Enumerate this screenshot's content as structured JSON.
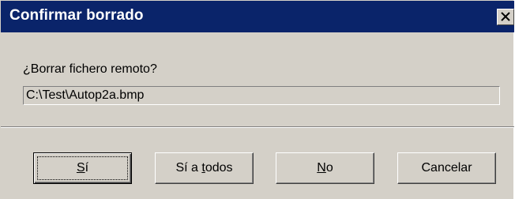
{
  "window": {
    "title": "Confirmar borrado",
    "close_icon": "close-icon"
  },
  "message": {
    "prompt": "¿Borrar fichero remoto?",
    "path": "C:\\Test\\Autop2a.bmp"
  },
  "buttons": {
    "yes": {
      "pre": "",
      "mnemonic": "S",
      "post": "í"
    },
    "yes_all": {
      "pre": "Sí a ",
      "mnemonic": "t",
      "post": "odos"
    },
    "no": {
      "pre": "",
      "mnemonic": "N",
      "post": "o"
    },
    "cancel": {
      "label": "Cancelar"
    }
  },
  "colors": {
    "titlebar": "#0a246a",
    "face": "#d4d0c8"
  }
}
